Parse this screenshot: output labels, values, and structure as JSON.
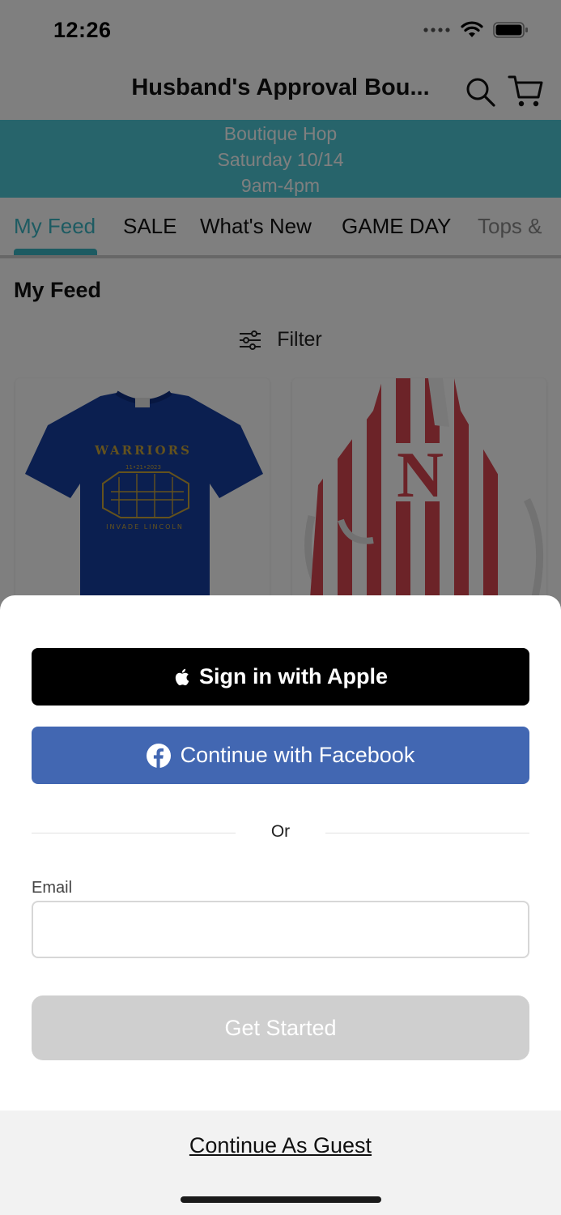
{
  "status_bar": {
    "time": "12:26"
  },
  "header": {
    "title": "Husband's Approval Bou..."
  },
  "banner": {
    "line1": "Boutique Hop",
    "line2": "Saturday 10/14",
    "line3": "9am-4pm"
  },
  "tabs": [
    {
      "label": "My Feed"
    },
    {
      "label": "SALE"
    },
    {
      "label": "What's New"
    },
    {
      "label": "GAME DAY"
    },
    {
      "label": "Tops &"
    }
  ],
  "feed": {
    "title": "My Feed",
    "filter_label": "Filter"
  },
  "products": [
    {
      "name": "blue-warriors-tshirt",
      "print_top": "WARRIORS",
      "print_date": "11•21•2023",
      "print_bottom": "INVADE LINCOLN"
    },
    {
      "name": "red-striped-n-apron",
      "print": "N"
    }
  ],
  "sheet": {
    "apple_label": "Sign in with Apple",
    "facebook_label": "Continue with Facebook",
    "or_label": "Or",
    "email_label": "Email",
    "email_value": "",
    "email_placeholder": "",
    "get_started_label": "Get Started",
    "guest_label": "Continue As Guest"
  },
  "colors": {
    "accent": "#3bb7c4",
    "banner": "#4fc9d6",
    "facebook": "#4267b2",
    "apple": "#000000",
    "disabled_button": "#cfcfcf"
  },
  "icons": {
    "search": "search-icon",
    "cart": "cart-icon",
    "filter": "sliders-icon",
    "apple": "apple-icon",
    "facebook": "facebook-icon"
  }
}
